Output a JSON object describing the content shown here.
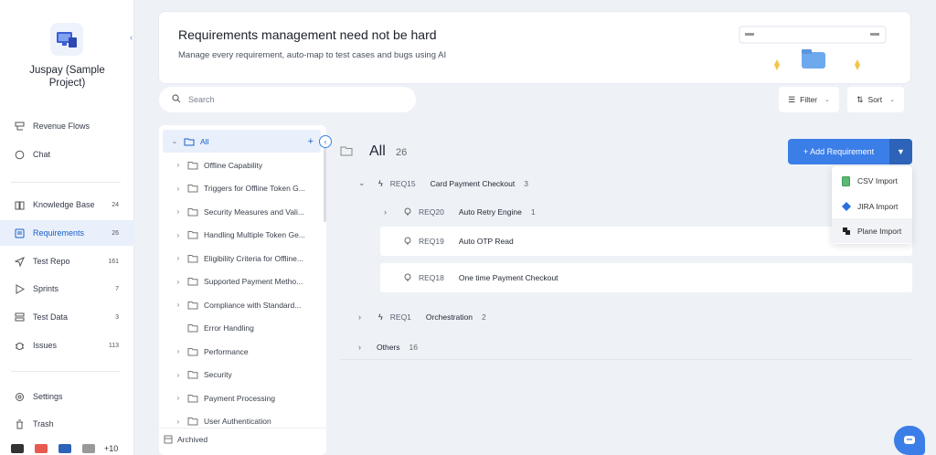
{
  "project": {
    "name_line1": "Juspay (Sample",
    "name_line2": "Project)"
  },
  "nav": {
    "revenue_flows": "Revenue Flows",
    "chat": "Chat",
    "knowledge_base": {
      "label": "Knowledge Base",
      "count": "24"
    },
    "requirements": {
      "label": "Requirements",
      "count": "26"
    },
    "test_repo": {
      "label": "Test Repo",
      "count": "161"
    },
    "sprints": {
      "label": "Sprints",
      "count": "7"
    },
    "test_data": {
      "label": "Test Data",
      "count": "3"
    },
    "issues": {
      "label": "Issues",
      "count": "113"
    },
    "settings": "Settings",
    "trash": "Trash",
    "extra_count": "+10"
  },
  "banner": {
    "title": "Requirements management need not be hard",
    "subtitle": "Manage every requirement, auto-map to test cases and bugs using AI"
  },
  "search": {
    "placeholder": "Search"
  },
  "toolbar": {
    "filter": "Filter",
    "sort": "Sort"
  },
  "tree": {
    "all": "All",
    "items": [
      "Offline Capability",
      "Triggers for Offline Token G...",
      "Security Measures and Vali...",
      "Handling Multiple Token Ge...",
      "Eligibility Criteria for Offline...",
      "Supported Payment Metho...",
      "Compliance with Standard...",
      "Error Handling",
      "Performance",
      "Security",
      "Payment Processing",
      "User Authentication"
    ],
    "archived": "Archived"
  },
  "main": {
    "title": "All",
    "count": "26",
    "add_button": "+ Add Requirement",
    "import_menu": [
      "CSV Import",
      "JIRA Import",
      "Plane Import"
    ],
    "rows": [
      {
        "id": "REQ15",
        "title": "Card Payment Checkout",
        "count": "3"
      },
      {
        "id": "REQ20",
        "title": "Auto Retry Engine",
        "count": "1"
      },
      {
        "id": "REQ19",
        "title": "Auto OTP Read"
      },
      {
        "id": "REQ18",
        "title": "One time Payment Checkout"
      },
      {
        "id": "REQ1",
        "title": "Orchestration",
        "count": "2"
      }
    ],
    "others": {
      "label": "Others",
      "count": "16"
    }
  },
  "colors": {
    "accent": "#3b7ee8",
    "active_bg": "#e9f0fb"
  }
}
